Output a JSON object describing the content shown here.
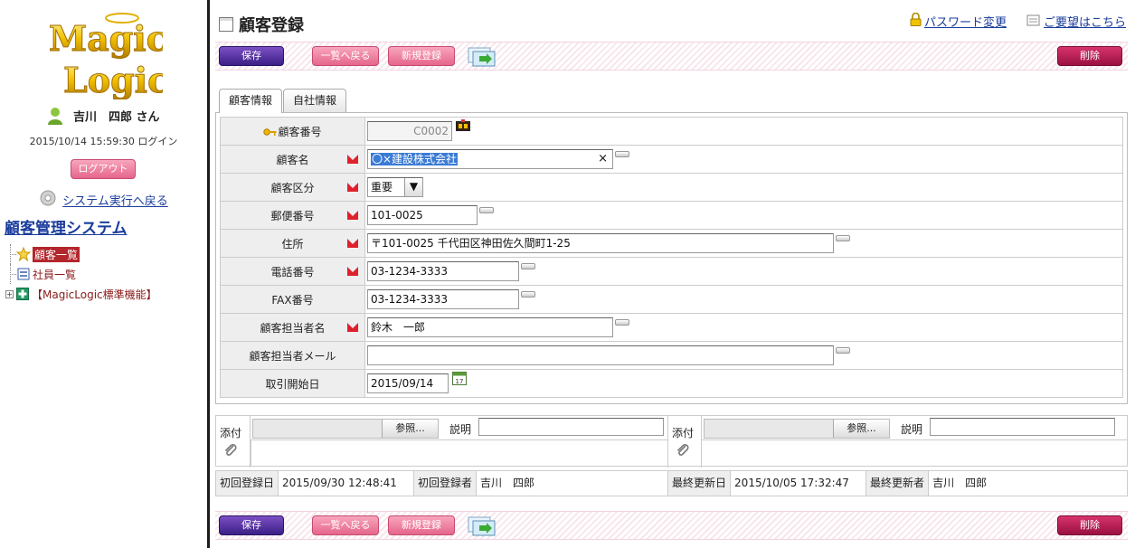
{
  "sidebar": {
    "logo_text": "Magic Logic",
    "user_name": "吉川　四郎 さん",
    "login_info": "2015/10/14 15:59:30 ログイン",
    "logout_label": "ログアウト",
    "back_link": "システム実行へ戻る",
    "system_title": "顧客管理システム",
    "tree": [
      {
        "label": "顧客一覧",
        "icon": "star-icon",
        "selected": true
      },
      {
        "label": "社員一覧",
        "icon": "list-icon",
        "selected": false
      },
      {
        "label": "【MagicLogic標準機能】",
        "icon": "plus-folder-icon",
        "selected": false
      }
    ]
  },
  "header": {
    "title": "顧客登録",
    "password_link": "パスワード変更",
    "request_link": "ご要望はこちら"
  },
  "toolbar": {
    "save": "保存",
    "back_list": "一覧へ戻る",
    "new": "新規登録",
    "delete": "削除"
  },
  "tabs": [
    "顧客情報",
    "自社情報"
  ],
  "form": {
    "customer_no": {
      "label": "顧客番号",
      "value": "C0002"
    },
    "customer_name": {
      "label": "顧客名",
      "value": "〇×建設株式会社"
    },
    "customer_type": {
      "label": "顧客区分",
      "value": "重要"
    },
    "postal": {
      "label": "郵便番号",
      "value": "101-0025"
    },
    "address": {
      "label": "住所",
      "value": "〒101-0025 千代田区神田佐久間町1-25"
    },
    "phone": {
      "label": "電話番号",
      "value": "03-1234-3333"
    },
    "fax": {
      "label": "FAX番号",
      "value": "03-1234-3333"
    },
    "contact_name": {
      "label": "顧客担当者名",
      "value": "鈴木　一郎"
    },
    "contact_mail": {
      "label": "顧客担当者メール",
      "value": ""
    },
    "start_date": {
      "label": "取引開始日",
      "value": "2015/09/14"
    }
  },
  "attachments": {
    "label": "添付",
    "browse": "参照...",
    "desc_label": "説明"
  },
  "audit": {
    "created_label": "初回登録日",
    "created_value": "2015/09/30 12:48:41",
    "creator_label": "初回登録者",
    "creator_value": "吉川　四郎",
    "updated_label": "最終更新日",
    "updated_value": "2015/10/05 17:32:47",
    "updater_label": "最終更新者",
    "updater_value": "吉川　四郎"
  },
  "colors": {
    "accent_blue": "#1a3c9c",
    "save_purple": "#3b1f86",
    "pink": "#e5668b",
    "delete_red": "#9a1042",
    "selected_red": "#b3262c"
  }
}
